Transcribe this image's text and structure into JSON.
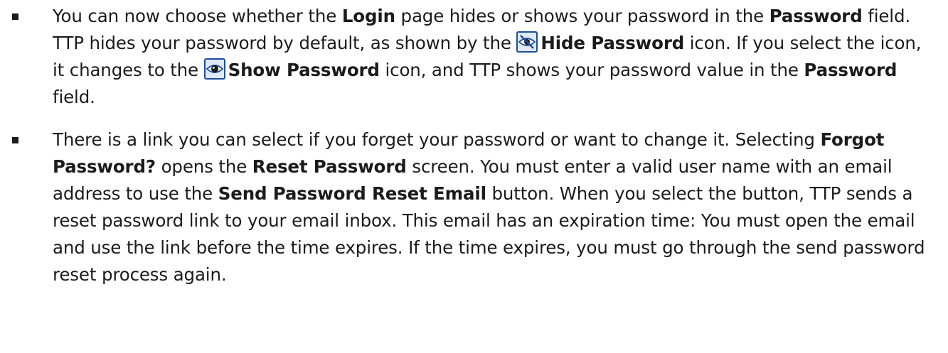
{
  "bullets": [
    {
      "segments": {
        "t1": "You can now choose whether the ",
        "b1": "Login",
        "t2": " page hides or shows your password in the ",
        "b2": "Password",
        "t3": " field. TTP hides your password by default, as shown by the ",
        "b3": "Hide Password",
        "t4": " icon. If you select the icon, it changes to the ",
        "b4": "Show Password",
        "t5": " icon, and TTP shows your password value in the ",
        "b5": "Password",
        "t6": " field."
      },
      "icons": {
        "hide": "eye-slash-icon",
        "show": "eye-icon"
      }
    },
    {
      "segments": {
        "t1": "There is a link you can select if you forget your password or want to change it. Selecting ",
        "b1": "Forgot Password?",
        "t2": " opens the ",
        "b2": "Reset Password",
        "t3": " screen. You must enter a valid user name with an email address to use the ",
        "b3": "Send Password Reset Email",
        "t4": " button. When you select the button, TTP sends a reset password link to your email inbox. This email has an expiration time: You must open the email and use the link before the time expires. If the time expires, you must go through the send password reset process again."
      }
    }
  ],
  "colors": {
    "text": "#1b1b1b",
    "icon_border": "#1f4e9c",
    "icon_fill": "#dfe9f7"
  }
}
